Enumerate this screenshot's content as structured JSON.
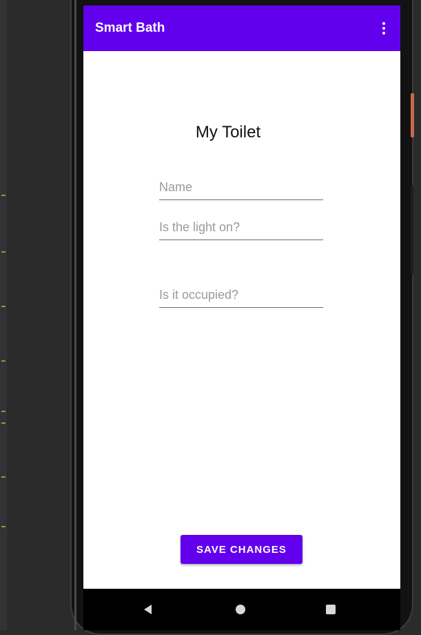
{
  "app_bar": {
    "title": "Smart Bath",
    "background_color": "#6200ee",
    "menu_icon": "overflow-menu-icon"
  },
  "page": {
    "title": "My Toilet"
  },
  "form": {
    "name_placeholder": "Name",
    "name_value": "",
    "light_placeholder": "Is the light on?",
    "light_value": "",
    "occupied_placeholder": "Is it occupied?",
    "occupied_value": ""
  },
  "actions": {
    "save_label": "SAVE CHANGES",
    "save_color": "#6200ee"
  },
  "nav_bar": {
    "back_icon": "back-triangle-icon",
    "home_icon": "home-circle-icon",
    "recents_icon": "recents-square-icon"
  }
}
